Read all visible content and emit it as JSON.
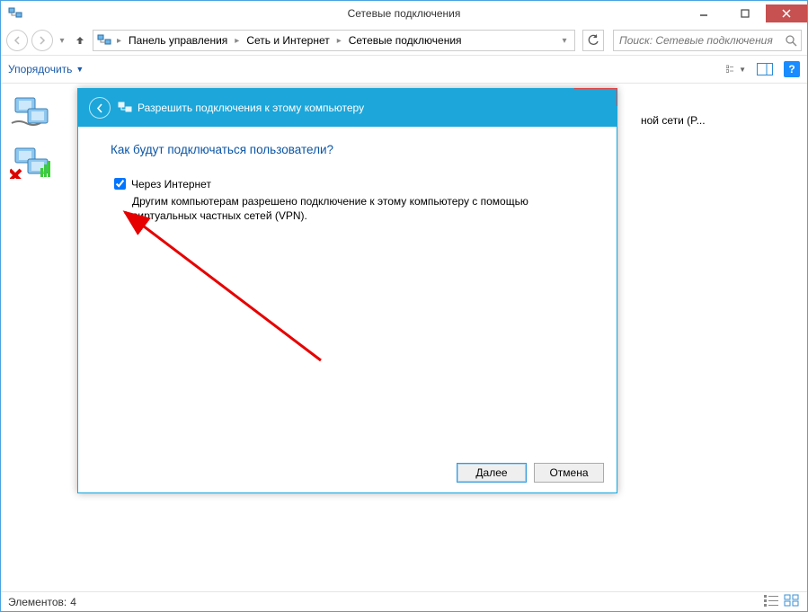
{
  "explorer": {
    "title": "Сетевые подключения",
    "breadcrumbs": {
      "items": [
        "Панель управления",
        "Сеть и Интернет",
        "Сетевые подключения"
      ]
    },
    "search_placeholder": "Поиск: Сетевые подключения",
    "organize_label": "Упорядочить",
    "status_label": "Элементов:",
    "status_count": "4",
    "bg_item_text": "ной сети (P..."
  },
  "dialog": {
    "title": "Разрешить подключения к этому компьютеру",
    "heading": "Как будут подключаться пользователи?",
    "checkbox_label": "Через Интернет",
    "checkbox_checked": true,
    "description": "Другим компьютерам разрешено подключение к этому компьютеру с помощью виртуальных частных сетей (VPN).",
    "next_button": "Далее",
    "cancel_button": "Отмена"
  }
}
